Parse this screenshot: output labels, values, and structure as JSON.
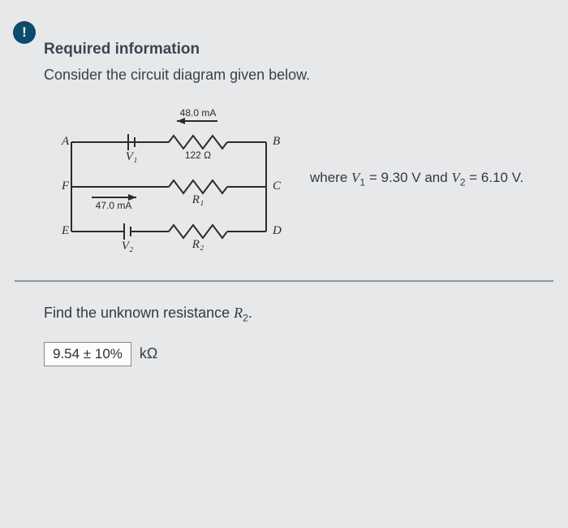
{
  "alert_glyph": "!",
  "header": "Required information",
  "intro": "Consider the circuit diagram given below.",
  "circuit": {
    "nodes": {
      "A": "A",
      "B": "B",
      "C": "C",
      "D": "D",
      "E": "E",
      "F": "F"
    },
    "top_current": "48.0 mA",
    "top_res_label": "122 Ω",
    "mid_current": "47.0 mA",
    "V1": "V₁",
    "V2": "V₂",
    "R1": "R₁",
    "R2": "R₂"
  },
  "where_prefix": "where ",
  "where_v1_sym": "V",
  "where_v1_sub": "1",
  "where_v1_val": " = 9.30 V and ",
  "where_v2_sym": "V",
  "where_v2_sub": "2",
  "where_v2_val": " = 6.10 V.",
  "question_prefix": "Find the unknown resistance ",
  "question_sym": "R",
  "question_sub": "2",
  "question_suffix": ".",
  "answer_value": "9.54 ± 10%",
  "answer_unit": "kΩ"
}
